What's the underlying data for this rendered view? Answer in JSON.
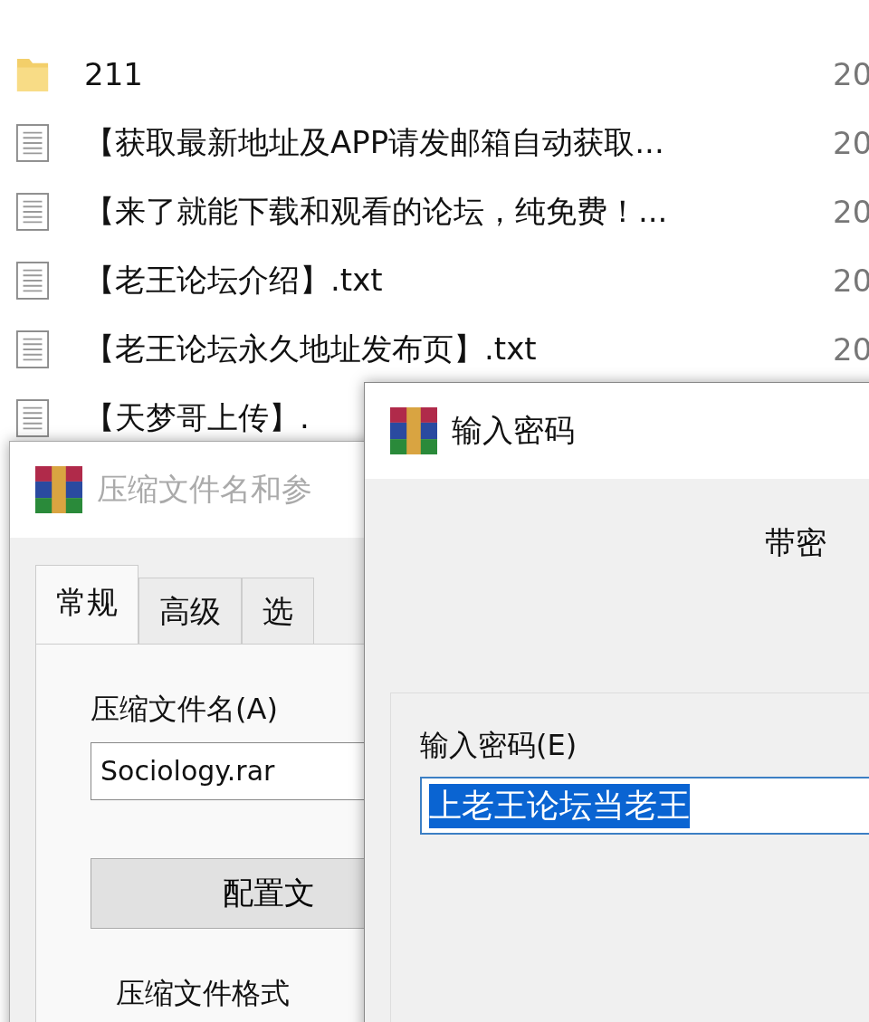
{
  "file_list": [
    {
      "kind": "folder",
      "name": "211",
      "column_2": "20"
    },
    {
      "kind": "text-file",
      "name": "【获取最新地址及APP请发邮箱自动获取...",
      "column_2": "20"
    },
    {
      "kind": "text-file",
      "name": "【来了就能下载和观看的论坛，纯免费！...",
      "column_2": "20"
    },
    {
      "kind": "text-file",
      "name": "【老王论坛介绍】.txt",
      "column_2": "20"
    },
    {
      "kind": "text-file",
      "name": "【老王论坛永久地址发布页】.txt",
      "column_2": "20"
    },
    {
      "kind": "text-file",
      "name": "【天梦哥上传】."
    }
  ],
  "archive_window": {
    "title": "压缩文件名和参",
    "tabs": [
      {
        "label": "常规",
        "selected": true
      },
      {
        "label": "高级",
        "selected": false
      },
      {
        "label": "选",
        "selected": false
      }
    ],
    "name_label": "压缩文件名(A)",
    "name_value": "Sociology.rar",
    "profiles_button": "配置文",
    "format_group": "压缩文件格式"
  },
  "password_dialog": {
    "title": "输入密码",
    "heading": "带密",
    "password_label": "输入密码(E)",
    "password_value": "上老王论坛当老王",
    "password_selected": true
  }
}
